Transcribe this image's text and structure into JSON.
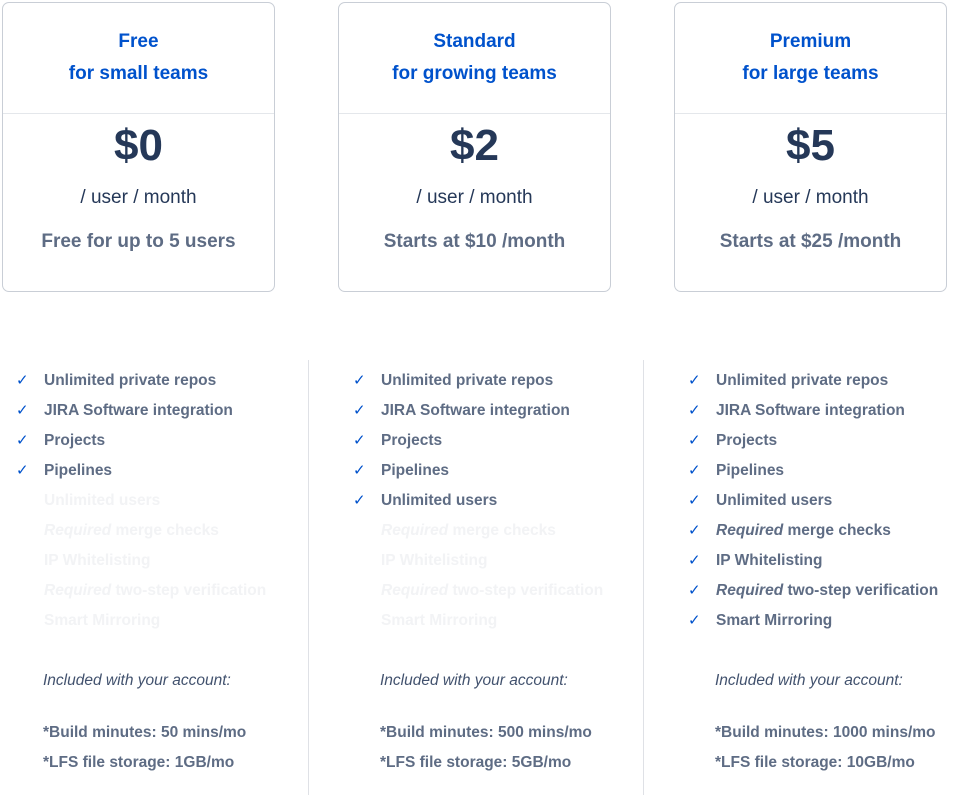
{
  "plans": [
    {
      "name": "Free",
      "tagline": "for small teams",
      "price": "$0",
      "per": "/ user / month",
      "note": "Free for up to 5 users",
      "included_label": "Included with your account:",
      "build_minutes": "*Build minutes: 50 mins/mo",
      "lfs_storage": "*LFS file storage: 1GB/mo"
    },
    {
      "name": "Standard",
      "tagline": "for growing teams",
      "price": "$2",
      "per": "/ user / month",
      "note": "Starts at $10 /month",
      "included_label": "Included with your account:",
      "build_minutes": "*Build minutes: 500 mins/mo",
      "lfs_storage": "*LFS file storage: 5GB/mo"
    },
    {
      "name": "Premium",
      "tagline": "for large teams",
      "price": "$5",
      "per": "/ user / month",
      "note": "Starts at $25 /month",
      "included_label": "Included with your account:",
      "build_minutes": "*Build minutes: 1000 mins/mo",
      "lfs_storage": "*LFS file storage: 10GB/mo"
    }
  ],
  "features": [
    {
      "prefix": "",
      "text": "Unlimited private repos",
      "included": [
        true,
        true,
        true
      ]
    },
    {
      "prefix": "",
      "text": "JIRA Software integration",
      "included": [
        true,
        true,
        true
      ]
    },
    {
      "prefix": "",
      "text": "Projects",
      "included": [
        true,
        true,
        true
      ]
    },
    {
      "prefix": "",
      "text": "Pipelines",
      "included": [
        true,
        true,
        true
      ]
    },
    {
      "prefix": "",
      "text": "Unlimited users",
      "included": [
        false,
        true,
        true
      ]
    },
    {
      "prefix": "Required",
      "text": " merge checks",
      "included": [
        false,
        false,
        true
      ]
    },
    {
      "prefix": "",
      "text": "IP Whitelisting",
      "included": [
        false,
        false,
        true
      ]
    },
    {
      "prefix": "Required",
      "text": " two-step verification",
      "included": [
        false,
        false,
        true
      ]
    },
    {
      "prefix": "",
      "text": "Smart Mirroring",
      "included": [
        false,
        false,
        true
      ]
    }
  ],
  "check_glyph": "✓",
  "colors": {
    "accent": "#0052cc",
    "price": "#253858",
    "text": "#5e6c84",
    "disabled": "#f2f3f5"
  }
}
